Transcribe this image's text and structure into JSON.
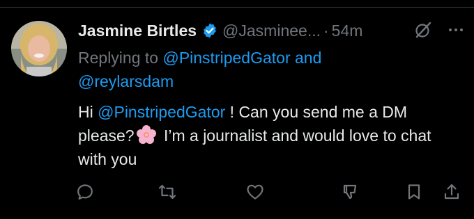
{
  "tweet": {
    "display_name": "Jasmine Birtles",
    "handle": "@Jasminee...",
    "separator": "·",
    "time": "54m",
    "replying_prefix": "Replying to",
    "replying_to_1": "@PinstripedGator",
    "replying_and": "and",
    "replying_to_2": "@reylarsdam",
    "text_part1": "Hi ",
    "text_mention": "@PinstripedGator",
    "text_part2": " ! Can you send me a DM please?",
    "emoji": "cherry-blossom",
    "text_part3": " I’m a journalist and would love to chat with you"
  },
  "icons": {
    "verified": "verified-badge-icon",
    "grok": "grok-icon",
    "more": "more-icon",
    "reply": "reply-icon",
    "retweet": "retweet-icon",
    "like": "like-icon",
    "dislike": "dislike-icon",
    "bookmark": "bookmark-icon",
    "share": "share-icon"
  },
  "colors": {
    "background": "#000000",
    "text": "#e7e9ea",
    "muted": "#71767b",
    "accent": "#1d9bf0"
  }
}
